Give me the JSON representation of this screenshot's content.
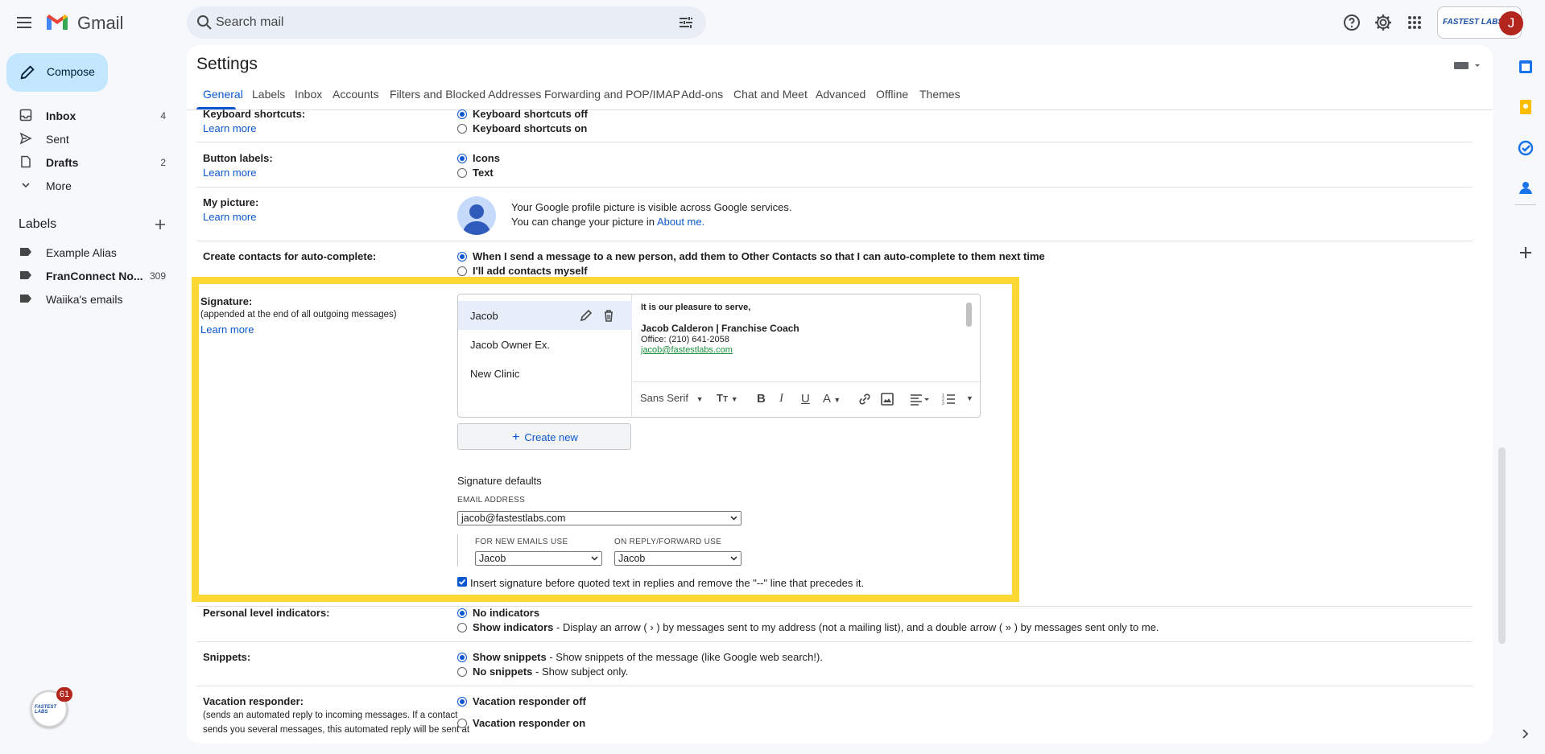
{
  "app": {
    "name": "Gmail",
    "search_placeholder": "Search mail",
    "avatar_initial": "J",
    "org_logo_text": "FASTEST LABS"
  },
  "nav": {
    "compose": "Compose",
    "items": [
      {
        "label": "Inbox",
        "count": "4",
        "bold": true,
        "icon": "inbox-icon"
      },
      {
        "label": "Sent",
        "count": "",
        "bold": false,
        "icon": "sent-icon"
      },
      {
        "label": "Drafts",
        "count": "2",
        "bold": true,
        "icon": "drafts-icon"
      },
      {
        "label": "More",
        "count": "",
        "bold": false,
        "icon": "chevron-down-icon"
      }
    ],
    "labels_title": "Labels",
    "labels": [
      {
        "label": "Example Alias",
        "count": "",
        "bold": false
      },
      {
        "label": "FranConnect No...",
        "count": "309",
        "bold": true
      },
      {
        "label": "Waiika's emails",
        "count": "",
        "bold": false
      }
    ],
    "floating_badge": {
      "text": "FASTEST LABS",
      "count": "61"
    }
  },
  "settings": {
    "title": "Settings",
    "tabs": [
      "General",
      "Labels",
      "Inbox",
      "Accounts",
      "Filters and Blocked Addresses",
      "Forwarding and POP/IMAP",
      "Add-ons",
      "Chat and Meet",
      "Advanced",
      "Offline",
      "Themes"
    ],
    "active_tab": "General",
    "learn_more": "Learn more",
    "keyboard": {
      "title": "Keyboard shortcuts:",
      "opt_off": "Keyboard shortcuts off",
      "opt_on": "Keyboard shortcuts on"
    },
    "button_labels": {
      "title": "Button labels:",
      "opt_icons": "Icons",
      "opt_text": "Text"
    },
    "picture": {
      "title": "My picture:",
      "line1": "Your Google profile picture is visible across Google services.",
      "line2_prefix": "You can change your picture in",
      "line2_link": "About me."
    },
    "contacts": {
      "title": "Create contacts for auto-complete:",
      "opt1": "When I send a message to a new person, add them to Other Contacts so that I can auto-complete to them next time",
      "opt2": "I'll add contacts myself"
    },
    "signature": {
      "title": "Signature:",
      "subtitle": "(appended at the end of all outgoing messages)",
      "list": [
        "Jacob",
        "Jacob Owner Ex.",
        "New Clinic"
      ],
      "body": {
        "greeting": "It is our pleasure to serve,",
        "name_line": "Jacob Calderon | Franchise Coach",
        "office": "Office: (210) 641-2058",
        "email": "jacob@fastestlabs.com"
      },
      "toolbar_font": "Sans Serif",
      "create_new": "Create new",
      "defaults_title": "Signature defaults",
      "email_label": "EMAIL ADDRESS",
      "email_value": "jacob@fastestlabs.com",
      "new_emails_label": "FOR NEW EMAILS USE",
      "new_emails_value": "Jacob",
      "reply_label": "ON REPLY/FORWARD USE",
      "reply_value": "Jacob",
      "insert_text": "Insert signature before quoted text in replies and remove the \"--\" line that precedes it."
    },
    "personal": {
      "title": "Personal level indicators:",
      "opt1": "No indicators",
      "opt2": "Show indicators",
      "opt2_desc": " - Display an arrow ( › ) by messages sent to my address (not a mailing list), and a double arrow ( » ) by messages sent only to me."
    },
    "snippets": {
      "title": "Snippets:",
      "opt1": "Show snippets",
      "opt1_desc": " - Show snippets of the message (like Google web search!).",
      "opt2": "No snippets",
      "opt2_desc": " - Show subject only."
    },
    "vacation": {
      "title": "Vacation responder:",
      "desc1": "(sends an automated reply to incoming messages. If a contact",
      "desc2": "sends you several messages, this automated reply will be sent at",
      "opt1": "Vacation responder off",
      "opt2": "Vacation responder on"
    }
  },
  "colors": {
    "accent": "#0b57d0",
    "highlight": "#fdd835",
    "compose_bg": "#c2e7ff"
  }
}
